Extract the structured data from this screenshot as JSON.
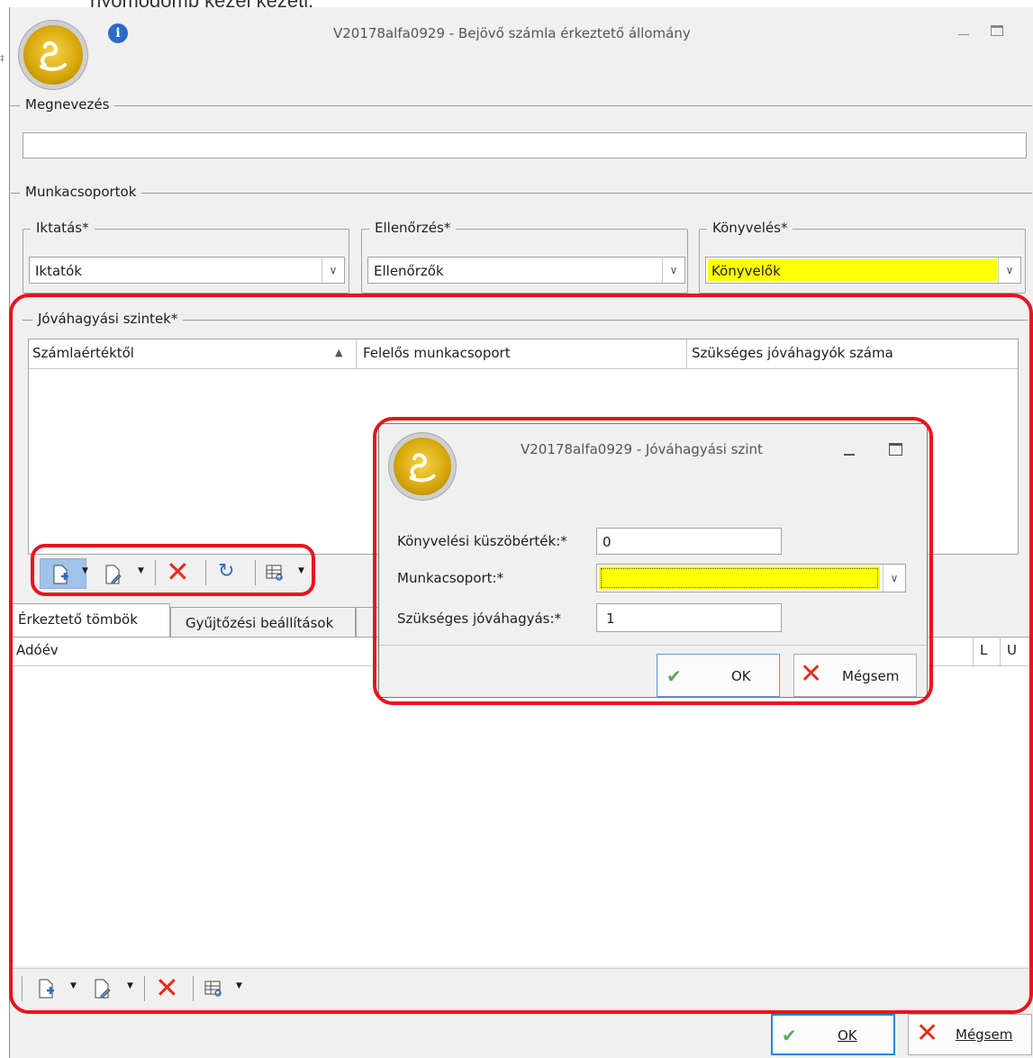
{
  "top_cut_text": "nyomógomb kezel kezeti.",
  "main_window": {
    "title": "V20178alfa0929 - Bejövő számla érkeztető állomány",
    "info_icon": "info-icon",
    "minimize_icon": "minimize-icon",
    "maximize_icon": "maximize-icon",
    "name_group": {
      "label": "Megnevezés",
      "value": ""
    },
    "workgroups": {
      "label": "Munkacsoportok",
      "iktatas": {
        "label": "Iktatás*",
        "value": "Iktatók"
      },
      "ellenorzes": {
        "label": "Ellenőrzés*",
        "value": "Ellenőrzők"
      },
      "konyveles": {
        "label": "Könyvelés*",
        "value": "Könyvelők"
      }
    },
    "approval_levels": {
      "label": "Jóváhagyási szintek*",
      "columns": [
        "Számlaértéktől",
        "Felelős munkacsoport",
        "Szükséges jóváhagyók száma"
      ],
      "sort_icon": "sort-ascending-icon"
    },
    "tabs": [
      "Érkeztető tömbök",
      "Gyűjtőzési beállítások"
    ],
    "lower_grid": {
      "columns": [
        "Adóév",
        "L",
        "U"
      ]
    },
    "ok_label": "OK",
    "cancel_label": "Mégsem"
  },
  "dialog": {
    "title": "V20178alfa0929 - Jóváhagyási szint",
    "fields": {
      "threshold_label": "Könyvelési küszöbérték:*",
      "threshold_value": "0",
      "workgroup_label": "Munkacsoport:*",
      "workgroup_value": "",
      "required_label": "Szükséges jóváhagyás:*",
      "required_value": "1"
    },
    "ok_label": "OK",
    "cancel_label": "Mégsem"
  },
  "colors": {
    "highlight": "#e8141c",
    "required_field": "#ffff00",
    "ok_check": "#5aa85a",
    "delete_x": "#e0301e"
  }
}
